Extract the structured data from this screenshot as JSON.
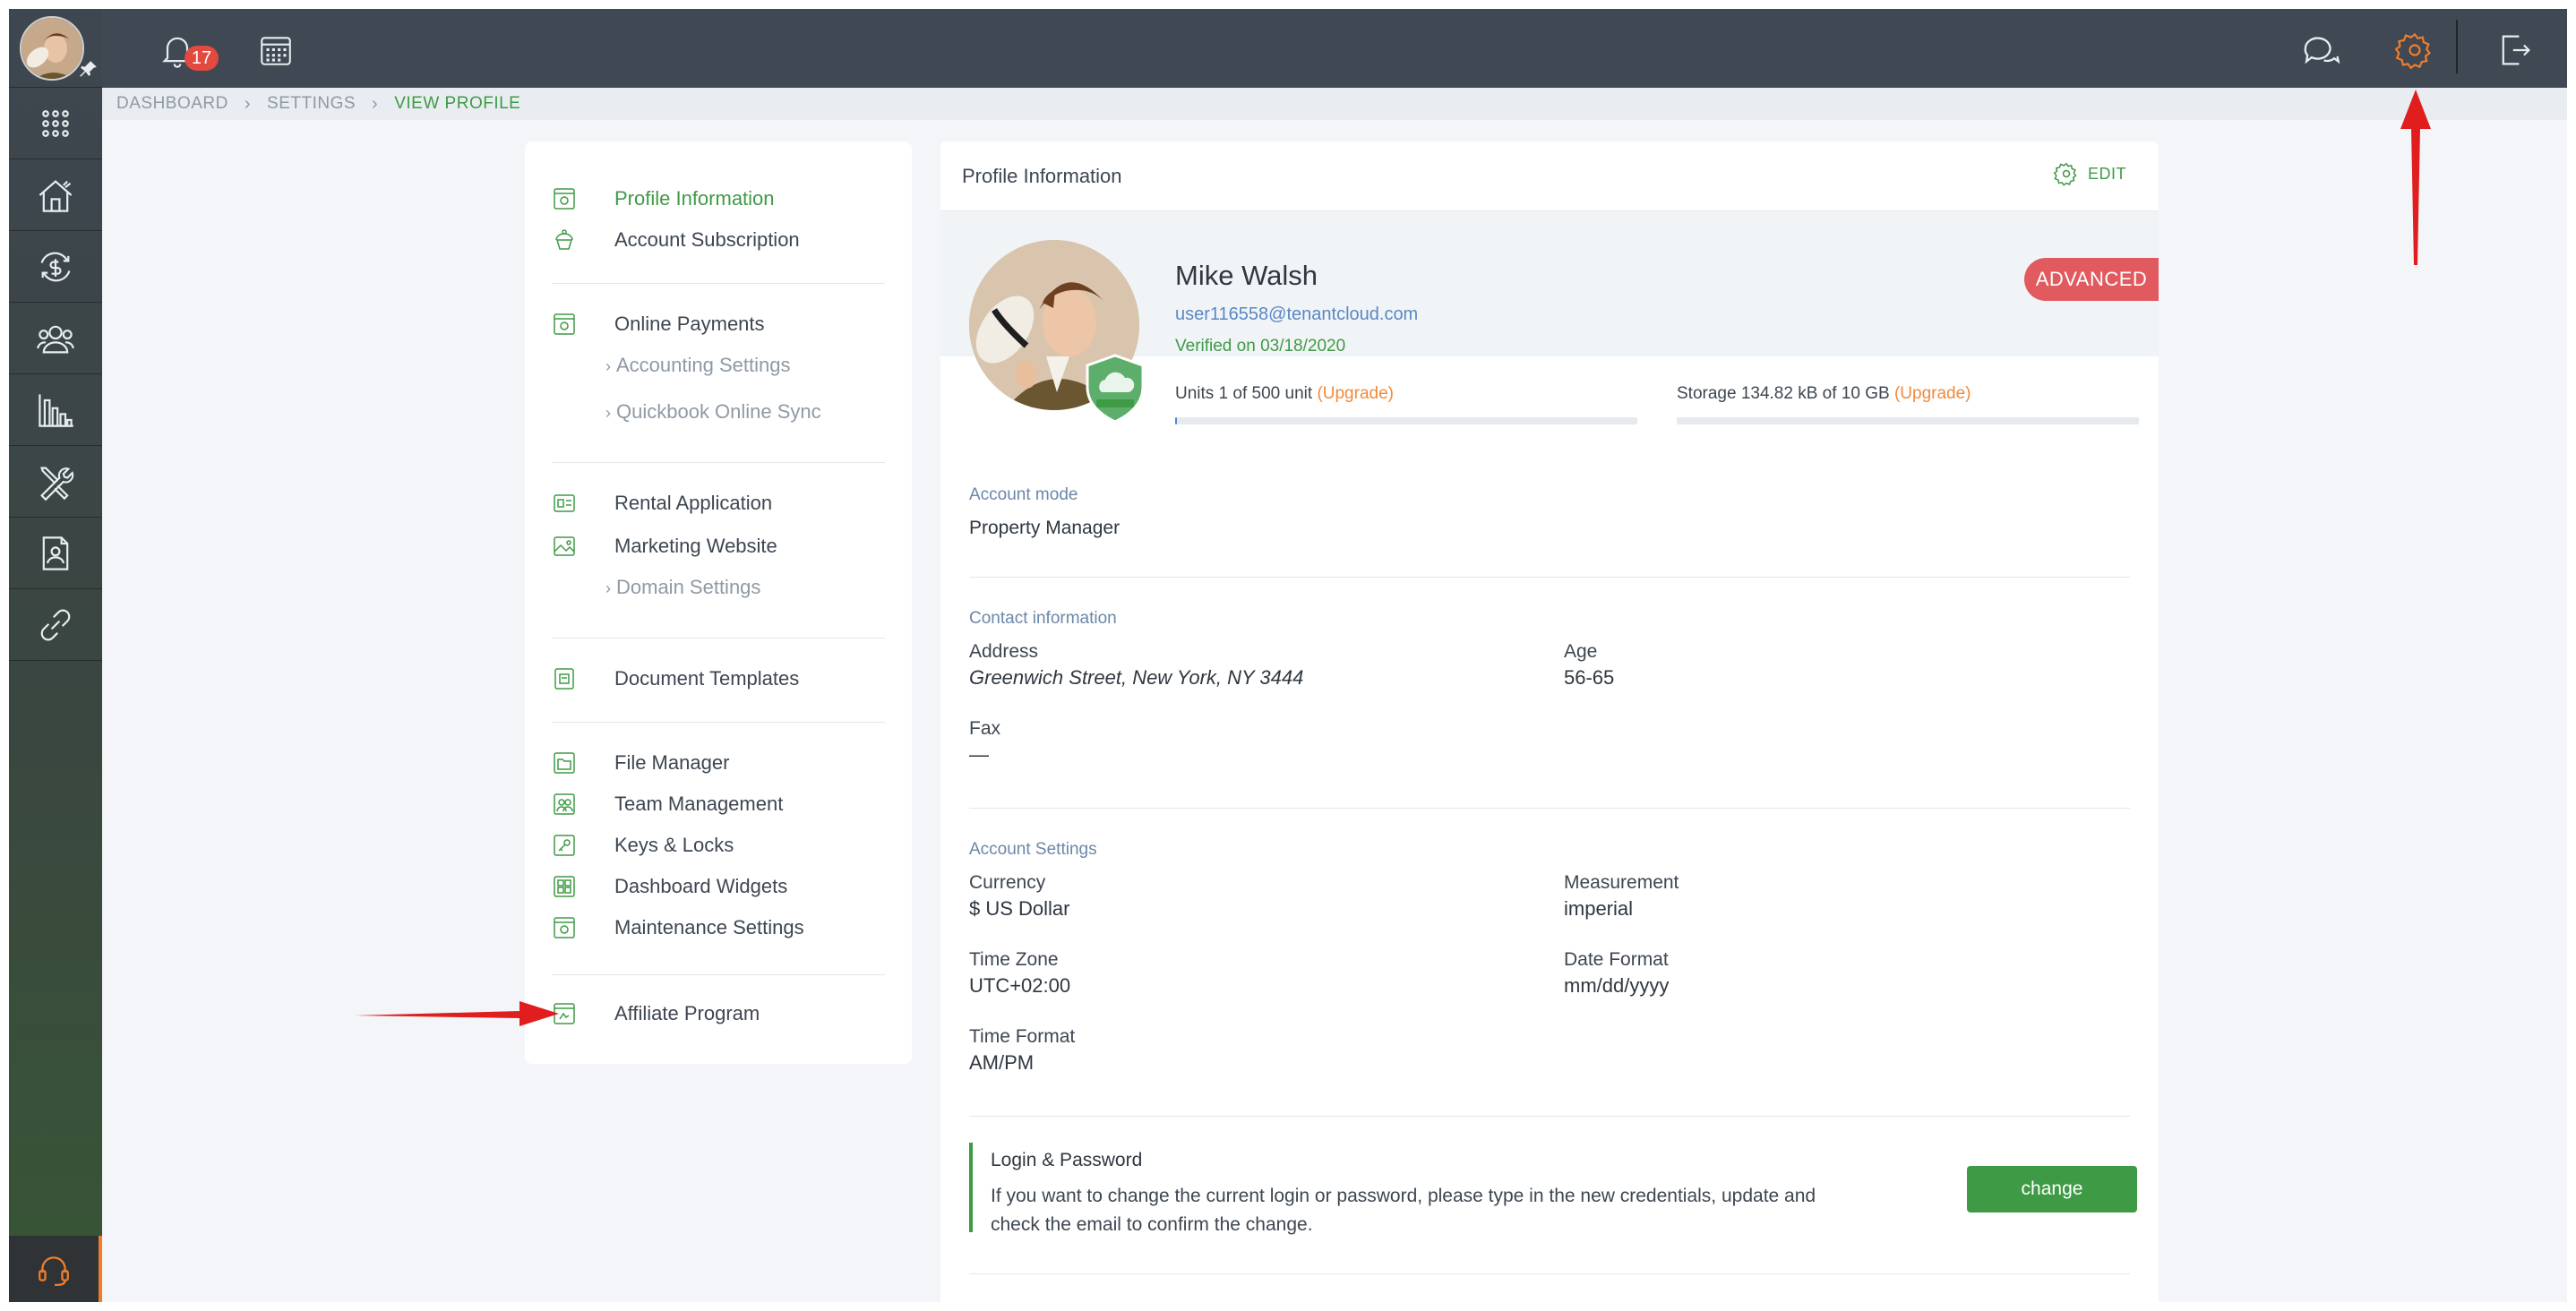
{
  "topbar": {
    "notifications_count": "17",
    "icons": [
      "bell-icon",
      "calendar-icon",
      "chat-icon",
      "gear-icon",
      "logout-icon"
    ],
    "accent_color": "#f07d2b"
  },
  "left_rail": {
    "items": [
      "apps-grid-icon",
      "properties-icon",
      "payments-icon",
      "people-icon",
      "reports-icon",
      "maintenance-tools-icon",
      "documents-icon",
      "link-icon"
    ],
    "support": "headset-icon"
  },
  "breadcrumb": {
    "items": [
      "DASHBOARD",
      "SETTINGS",
      "VIEW PROFILE"
    ]
  },
  "settings_menu": {
    "items": [
      {
        "label": "Profile Information",
        "active": true
      },
      {
        "label": "Account Subscription"
      },
      {
        "label": "Online Payments"
      },
      {
        "label": "Accounting Settings",
        "sub": true
      },
      {
        "label": "Quickbook Online Sync",
        "sub": true
      },
      {
        "label": "Rental Application"
      },
      {
        "label": "Marketing Website"
      },
      {
        "label": "Domain Settings",
        "sub": true
      },
      {
        "label": "Document Templates"
      },
      {
        "label": "File Manager"
      },
      {
        "label": "Team Management"
      },
      {
        "label": "Keys & Locks"
      },
      {
        "label": "Dashboard Widgets"
      },
      {
        "label": "Maintenance Settings"
      },
      {
        "label": "Affiliate Program"
      }
    ]
  },
  "profile": {
    "panel_title": "Profile Information",
    "edit_label": "EDIT",
    "name": "Mike Walsh",
    "email": "user116558@tenantcloud.com",
    "verified": "Verified on 03/18/2020",
    "plan_badge": "ADVANCED",
    "badge_color": "#e05a5f",
    "units": {
      "label": "Units 1 of 500 unit",
      "upgrade": "(Upgrade)",
      "fill": 0.002
    },
    "storage": {
      "label": "Storage 134.82 kB of 10 GB",
      "upgrade": "(Upgrade)",
      "fill": 0.0
    }
  },
  "account_mode": {
    "title": "Account mode",
    "value": "Property Manager"
  },
  "contact_info": {
    "title": "Contact information",
    "address_label": "Address",
    "address_value": "Greenwich Street, New York, NY 3444",
    "age_label": "Age",
    "age_value": "56-65",
    "fax_label": "Fax",
    "fax_value": "—"
  },
  "account_settings": {
    "title": "Account Settings",
    "currency_label": "Currency",
    "currency_value": "$ US Dollar",
    "measurement_label": "Measurement",
    "measurement_value": "imperial",
    "timezone_label": "Time Zone",
    "timezone_value": "UTC+02:00",
    "dateformat_label": "Date Format",
    "dateformat_value": "mm/dd/yyyy",
    "timeformat_label": "Time Format",
    "timeformat_value": "AM/PM"
  },
  "login_password": {
    "title": "Login & Password",
    "description": "If you want to change the current login or password, please type in the new credentials, update and check the email to confirm the change.",
    "button": "change"
  }
}
